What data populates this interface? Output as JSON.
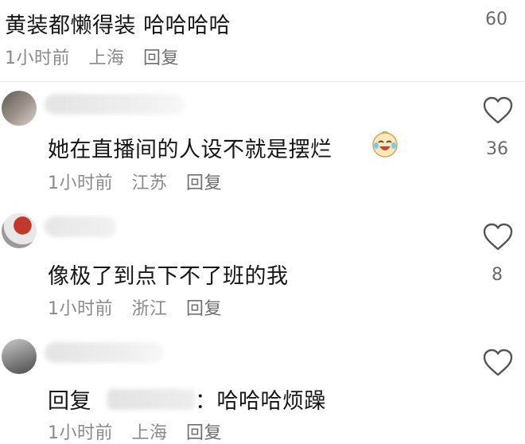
{
  "comments": [
    {
      "text": "黄装都懒得装 哈哈哈哈",
      "time": "1小时前",
      "location": "上海",
      "reply_label": "回复",
      "like_count": "60"
    },
    {
      "text": "她在直播间的人设不就是摆烂",
      "emoji_icon": "laughing-crying-face",
      "time": "1小时前",
      "location": "江苏",
      "reply_label": "回复",
      "like_count": "36"
    },
    {
      "text": "像极了到点下不了班的我",
      "time": "1小时前",
      "location": "浙江",
      "reply_label": "回复",
      "like_count": "8"
    },
    {
      "reply_prefix": "回复",
      "text_suffix": "：哈哈哈烦躁",
      "time": "1小时前",
      "location": "上海",
      "reply_label": "回复"
    }
  ],
  "colors": {
    "text": "#161616",
    "meta": "#8a8a8a",
    "heart_stroke": "#555555"
  },
  "icons": [
    "heart-outline-icon",
    "laughing-crying-emoji-icon"
  ]
}
